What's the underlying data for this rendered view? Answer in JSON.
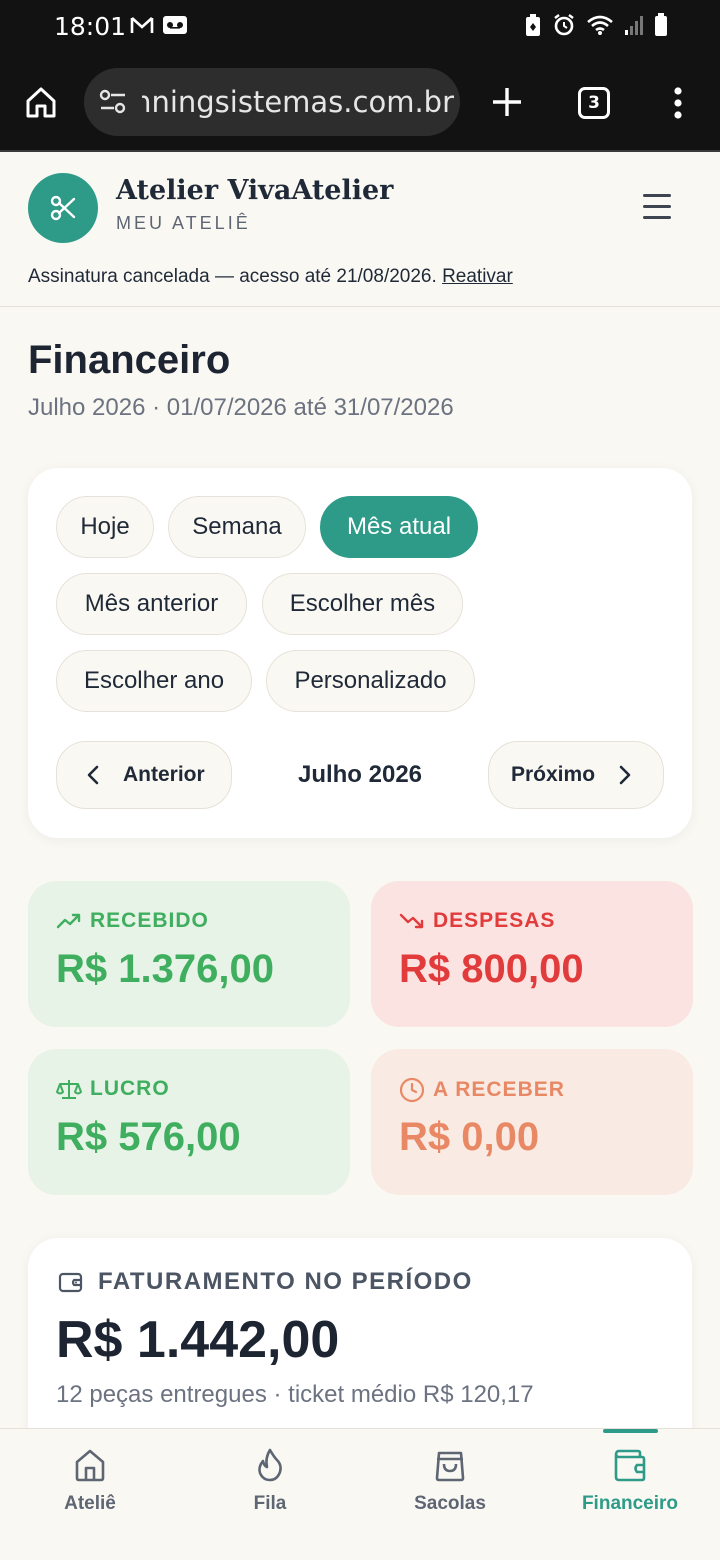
{
  "status_bar": {
    "time": "18:01"
  },
  "browser": {
    "url": "nningsistemas.com.br",
    "tab_count": "3"
  },
  "header": {
    "brand_name": "Atelier VivaAtelier",
    "brand_sub": "MEU ATELIÊ",
    "notice_text": "Assinatura cancelada — acesso até 21/08/2026.",
    "notice_link": "Reativar"
  },
  "page": {
    "title": "Financeiro",
    "subtitle": "Julho 2026 · 01/07/2026 até 31/07/2026"
  },
  "filters": {
    "chips": [
      "Hoje",
      "Semana",
      "Mês atual",
      "Mês anterior",
      "Escolher mês",
      "Escolher ano",
      "Personalizado"
    ],
    "active": "Mês atual",
    "prev_label": "Anterior",
    "next_label": "Próximo",
    "period_label": "Julho 2026"
  },
  "stats": {
    "recebido": {
      "label": "RECEBIDO",
      "value": "R$ 1.376,00",
      "color": "#3fae5f",
      "bg": "#e6f3e6"
    },
    "despesas": {
      "label": "DESPESAS",
      "value": "R$ 800,00",
      "color": "#e23b3b",
      "bg": "#fae3e1"
    },
    "lucro": {
      "label": "LUCRO",
      "value": "R$ 576,00",
      "color": "#3fae5f",
      "bg": "#e6f3e6"
    },
    "a_receber": {
      "label": "A RECEBER",
      "value": "R$ 0,00",
      "color": "#e88865",
      "bg": "#f9ebe3"
    }
  },
  "faturamento": {
    "label": "FATURAMENTO NO PERÍODO",
    "value": "R$ 1.442,00",
    "detail": "12 peças entregues · ticket médio R$ 120,17"
  },
  "bottom_nav": {
    "items": [
      "Ateliê",
      "Fila",
      "Sacolas",
      "Financeiro"
    ],
    "active": "Financeiro"
  },
  "colors": {
    "accent": "#2e9b88",
    "background": "#faf8f3"
  }
}
